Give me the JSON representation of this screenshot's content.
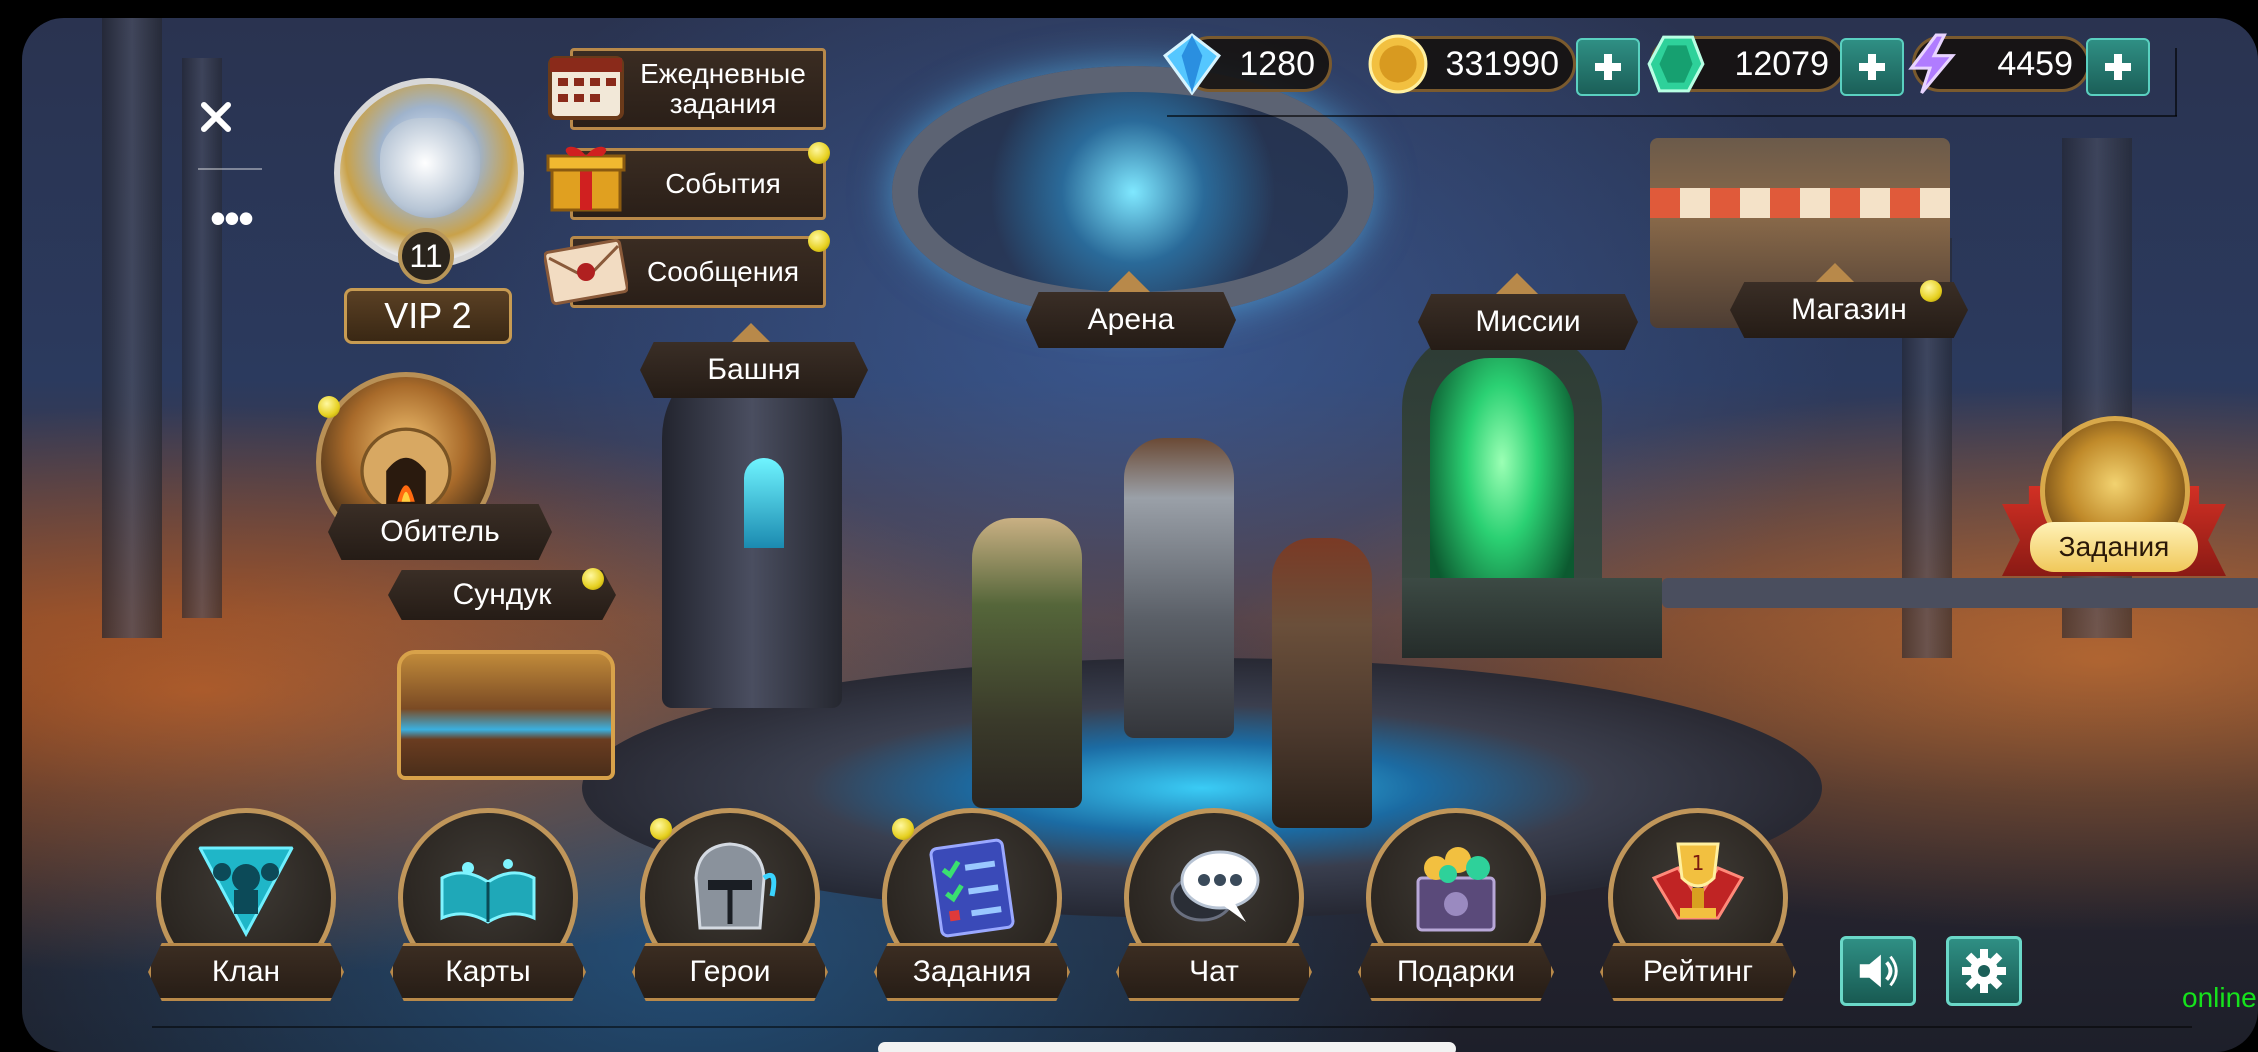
{
  "resources": {
    "crystals": {
      "value": "1280",
      "icon": "blue-crystal-icon",
      "color": "#4ab8ff"
    },
    "gold": {
      "value": "331990",
      "icon": "gold-coin-icon",
      "color": "#f2c040"
    },
    "emeralds": {
      "value": "12079",
      "icon": "green-gem-icon",
      "color": "#2ed19a"
    },
    "energy": {
      "value": "4459",
      "icon": "lightning-icon",
      "color": "#a86cff"
    }
  },
  "player": {
    "level": "11",
    "vip": "VIP 2"
  },
  "left_menu": [
    {
      "label": "Ежедневные задания",
      "icon": "calendar-icon",
      "notification": false
    },
    {
      "label": "События",
      "icon": "gift-icon",
      "notification": true
    },
    {
      "label": "Сообщения",
      "icon": "envelope-icon",
      "notification": true
    }
  ],
  "locations": {
    "arena": "Арена",
    "tower": "Башня",
    "missions": "Миссии",
    "shop": "Магазин",
    "abode": "Обитель",
    "chest": "Сундук",
    "quests": "Задания"
  },
  "bottom_nav": [
    {
      "label": "Клан",
      "icon": "clan-icon",
      "notification": false
    },
    {
      "label": "Карты",
      "icon": "cards-book-icon",
      "notification": false
    },
    {
      "label": "Герои",
      "icon": "helmet-icon",
      "notification": true
    },
    {
      "label": "Задания",
      "icon": "checklist-icon",
      "notification": true
    },
    {
      "label": "Чат",
      "icon": "chat-bubble-icon",
      "notification": false
    },
    {
      "label": "Подарки",
      "icon": "treasure-box-icon",
      "notification": false
    },
    {
      "label": "Рейтинг",
      "icon": "trophy-icon",
      "notification": false
    }
  ],
  "status": "online",
  "colors": {
    "frame": "#b8894a",
    "accent_teal": "#2f8f84",
    "online": "#16e21c",
    "notify": "#e6d020"
  }
}
